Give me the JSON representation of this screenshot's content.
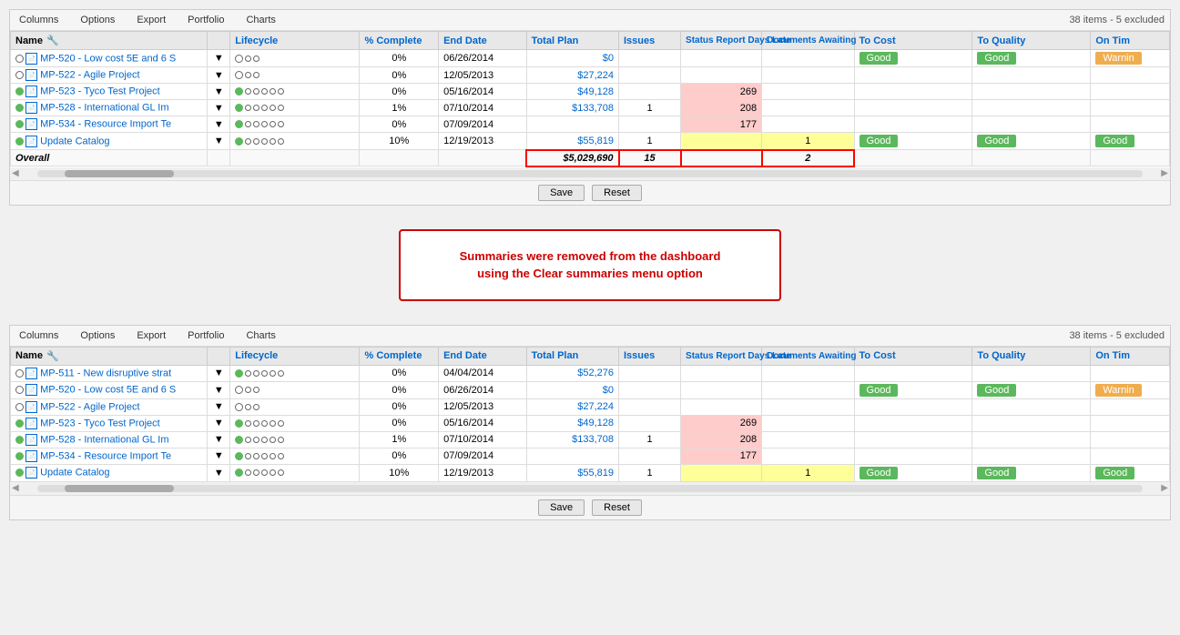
{
  "top_panel": {
    "menu": [
      "Columns",
      "Options",
      "Export",
      "Portfolio",
      "Charts"
    ],
    "items_count": "38 items - 5 excluded",
    "columns": {
      "name": "Name",
      "lifecycle": "Lifecycle",
      "pct_complete": "% Complete",
      "end_date": "End Date",
      "total_plan": "Total Plan",
      "issues": "Issues",
      "status_report_days_late": "Status Report Days Late",
      "documents_awaiting": "Documents Awaiting",
      "to_cost": "To Cost",
      "to_quality": "To Quality",
      "on_time": "On Tim"
    },
    "rows": [
      {
        "icon": "circle-page",
        "name": "MP-520 - Low cost 5E and 6 S",
        "lifecycle_type": "simple",
        "lifecycle_dots": 3,
        "lifecycle_filled": 1,
        "pct": "0%",
        "end_date": "06/26/2014",
        "total_plan": "$0",
        "issues": "",
        "srdl": "",
        "srdl_pink": false,
        "doc_await": "",
        "to_cost": "Good",
        "to_quality": "Good",
        "on_time": "Warnin"
      },
      {
        "icon": "circle-page",
        "name": "MP-522 - Agile Project",
        "lifecycle_type": "simple",
        "lifecycle_dots": 3,
        "lifecycle_filled": 1,
        "pct": "0%",
        "end_date": "12/05/2013",
        "total_plan": "$27,224",
        "issues": "",
        "srdl": "",
        "srdl_pink": false,
        "doc_await": "",
        "to_cost": "",
        "to_quality": "",
        "on_time": ""
      },
      {
        "icon": "circle-page-green",
        "name": "MP-523 - Tyco Test Project",
        "lifecycle_type": "full",
        "lifecycle_dots": 6,
        "lifecycle_filled": 1,
        "pct": "0%",
        "end_date": "05/16/2014",
        "total_plan": "$49,128",
        "issues": "",
        "srdl": "269",
        "srdl_pink": true,
        "doc_await": "",
        "to_cost": "",
        "to_quality": "",
        "on_time": ""
      },
      {
        "icon": "circle-page-green",
        "name": "MP-528 - International GL Im",
        "lifecycle_type": "full",
        "lifecycle_dots": 6,
        "lifecycle_filled": 1,
        "pct": "1%",
        "end_date": "07/10/2014",
        "total_plan": "$133,708",
        "issues": "1",
        "srdl": "208",
        "srdl_pink": true,
        "doc_await": "",
        "to_cost": "",
        "to_quality": "",
        "on_time": ""
      },
      {
        "icon": "circle-page-green",
        "name": "MP-534 - Resource Import Te",
        "lifecycle_type": "full",
        "lifecycle_dots": 6,
        "lifecycle_filled": 1,
        "pct": "0%",
        "end_date": "07/09/2014",
        "total_plan": "",
        "issues": "",
        "srdl": "177",
        "srdl_pink": true,
        "doc_await": "",
        "to_cost": "",
        "to_quality": "",
        "on_time": ""
      },
      {
        "icon": "circle-page-green",
        "name": "Update Catalog",
        "lifecycle_type": "full",
        "lifecycle_dots": 6,
        "lifecycle_filled": 1,
        "pct": "10%",
        "end_date": "12/19/2013",
        "total_plan": "$55,819",
        "issues": "1",
        "srdl": "",
        "srdl_pink": false,
        "srdl_yellow": true,
        "doc_await": "1",
        "to_cost": "Good",
        "to_quality": "Good",
        "on_time": "Good"
      }
    ],
    "overall": {
      "label": "Overall",
      "total_plan": "$5,029,690",
      "issues": "15",
      "doc_await": "2"
    },
    "save_btn": "Save",
    "reset_btn": "Reset"
  },
  "message": {
    "line1": "Summaries were removed from the dashboard",
    "line2": "using the Clear summaries menu option"
  },
  "bottom_panel": {
    "menu": [
      "Columns",
      "Options",
      "Export",
      "Portfolio",
      "Charts"
    ],
    "items_count": "38 items - 5 excluded",
    "rows": [
      {
        "icon": "circle-page",
        "name": "MP-511 - New disruptive strat",
        "lifecycle_type": "full",
        "lifecycle_dots": 5,
        "lifecycle_filled": 0,
        "pct": "0%",
        "end_date": "04/04/2014",
        "total_plan": "$52,276",
        "issues": "",
        "srdl": "",
        "srdl_pink": false,
        "doc_await": "",
        "to_cost": "",
        "to_quality": "",
        "on_time": ""
      },
      {
        "icon": "circle-page",
        "name": "MP-520 - Low cost 5E and 6 S",
        "lifecycle_type": "simple",
        "lifecycle_dots": 3,
        "lifecycle_filled": 1,
        "pct": "0%",
        "end_date": "06/26/2014",
        "total_plan": "$0",
        "issues": "",
        "srdl": "",
        "srdl_pink": false,
        "doc_await": "",
        "to_cost": "Good",
        "to_quality": "Good",
        "on_time": "Warnin"
      },
      {
        "icon": "circle-page",
        "name": "MP-522 - Agile Project",
        "lifecycle_type": "simple",
        "lifecycle_dots": 3,
        "lifecycle_filled": 1,
        "pct": "0%",
        "end_date": "12/05/2013",
        "total_plan": "$27,224",
        "issues": "",
        "srdl": "",
        "srdl_pink": false,
        "doc_await": "",
        "to_cost": "",
        "to_quality": "",
        "on_time": ""
      },
      {
        "icon": "circle-page-green",
        "name": "MP-523 - Tyco Test Project",
        "lifecycle_type": "full",
        "lifecycle_dots": 6,
        "lifecycle_filled": 1,
        "pct": "0%",
        "end_date": "05/16/2014",
        "total_plan": "$49,128",
        "issues": "",
        "srdl": "269",
        "srdl_pink": true,
        "doc_await": "",
        "to_cost": "",
        "to_quality": "",
        "on_time": ""
      },
      {
        "icon": "circle-page-green",
        "name": "MP-528 - International GL Im",
        "lifecycle_type": "full",
        "lifecycle_dots": 6,
        "lifecycle_filled": 1,
        "pct": "1%",
        "end_date": "07/10/2014",
        "total_plan": "$133,708",
        "issues": "1",
        "srdl": "208",
        "srdl_pink": true,
        "doc_await": "",
        "to_cost": "",
        "to_quality": "",
        "on_time": ""
      },
      {
        "icon": "circle-page-green",
        "name": "MP-534 - Resource Import Te",
        "lifecycle_type": "full",
        "lifecycle_dots": 6,
        "lifecycle_filled": 1,
        "pct": "0%",
        "end_date": "07/09/2014",
        "total_plan": "",
        "issues": "",
        "srdl": "177",
        "srdl_pink": true,
        "doc_await": "",
        "to_cost": "",
        "to_quality": "",
        "on_time": ""
      },
      {
        "icon": "circle-page-green",
        "name": "Update Catalog",
        "lifecycle_type": "full",
        "lifecycle_dots": 6,
        "lifecycle_filled": 1,
        "pct": "10%",
        "end_date": "12/19/2013",
        "total_plan": "$55,819",
        "issues": "1",
        "srdl": "",
        "srdl_pink": false,
        "srdl_yellow": true,
        "doc_await": "1",
        "to_cost": "Good",
        "to_quality": "Good",
        "on_time": "Good"
      }
    ],
    "save_btn": "Save",
    "reset_btn": "Reset"
  }
}
